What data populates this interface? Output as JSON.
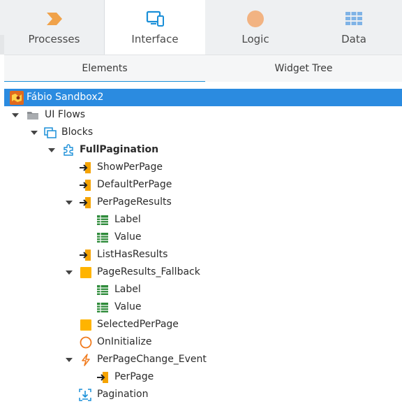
{
  "top_tabs": [
    {
      "label": "Processes",
      "icon": "processes-icon"
    },
    {
      "label": "Interface",
      "icon": "interface-icon"
    },
    {
      "label": "Logic",
      "icon": "logic-icon"
    },
    {
      "label": "Data",
      "icon": "data-icon"
    }
  ],
  "sub_tabs": [
    {
      "label": "Elements"
    },
    {
      "label": "Widget Tree"
    }
  ],
  "tree": {
    "app": "Fábio Sandbox2",
    "ui_flows": "UI Flows",
    "blocks": "Blocks",
    "full_pagination": "FullPagination",
    "show_per_page": "ShowPerPage",
    "default_per_page": "DefaultPerPage",
    "per_page_results": "PerPageResults",
    "ppr_label": "Label",
    "ppr_value": "Value",
    "list_has_results": "ListHasResults",
    "page_results_fallback": "PageResults_Fallback",
    "prf_label": "Label",
    "prf_value": "Value",
    "selected_per_page": "SelectedPerPage",
    "on_initialize": "OnInitialize",
    "per_page_change_event": "PerPageChange_Event",
    "per_page": "PerPage",
    "pagination": "Pagination"
  },
  "colors": {
    "accent": "#1a8fd8",
    "selection": "#2b8be0",
    "input_param": "#f5a300",
    "local_var": "#ffb400",
    "structure_green": "#2e8b3a"
  }
}
